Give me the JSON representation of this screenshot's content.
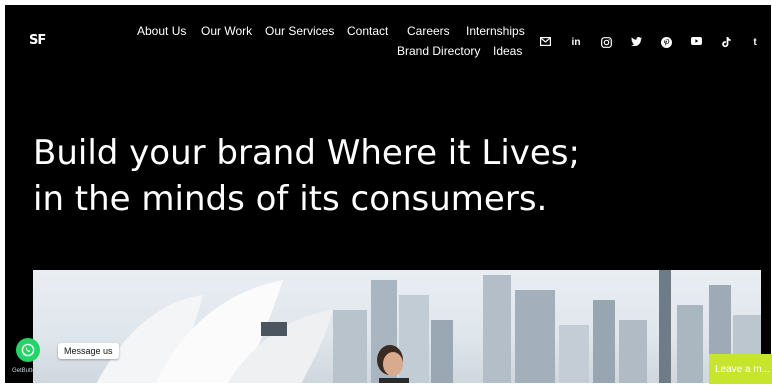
{
  "brand": {
    "logo_text": "SF"
  },
  "nav": {
    "row1": [
      "About Us",
      "Our Work",
      "Our Services",
      "Contact",
      "Careers",
      "Internships"
    ],
    "row2": [
      "Brand Directory",
      "Ideas"
    ]
  },
  "social": {
    "icons": [
      "mail-icon",
      "linkedin-icon",
      "instagram-icon",
      "twitter-icon",
      "pinterest-icon",
      "youtube-icon",
      "tiktok-icon",
      "tumblr-icon"
    ],
    "linkedin_text": "in",
    "tumblr_text": "t"
  },
  "hero": {
    "line1": "Build your brand Where it Lives;",
    "line2": "in the minds of its consumers."
  },
  "widgets": {
    "whatsapp_tooltip": "Message us",
    "getbutton_credit": "GetButton",
    "chat_label": "Leave a m..."
  },
  "colors": {
    "background": "#000000",
    "text": "#ffffff",
    "whatsapp": "#25d366",
    "chat": "#c7e52c"
  }
}
